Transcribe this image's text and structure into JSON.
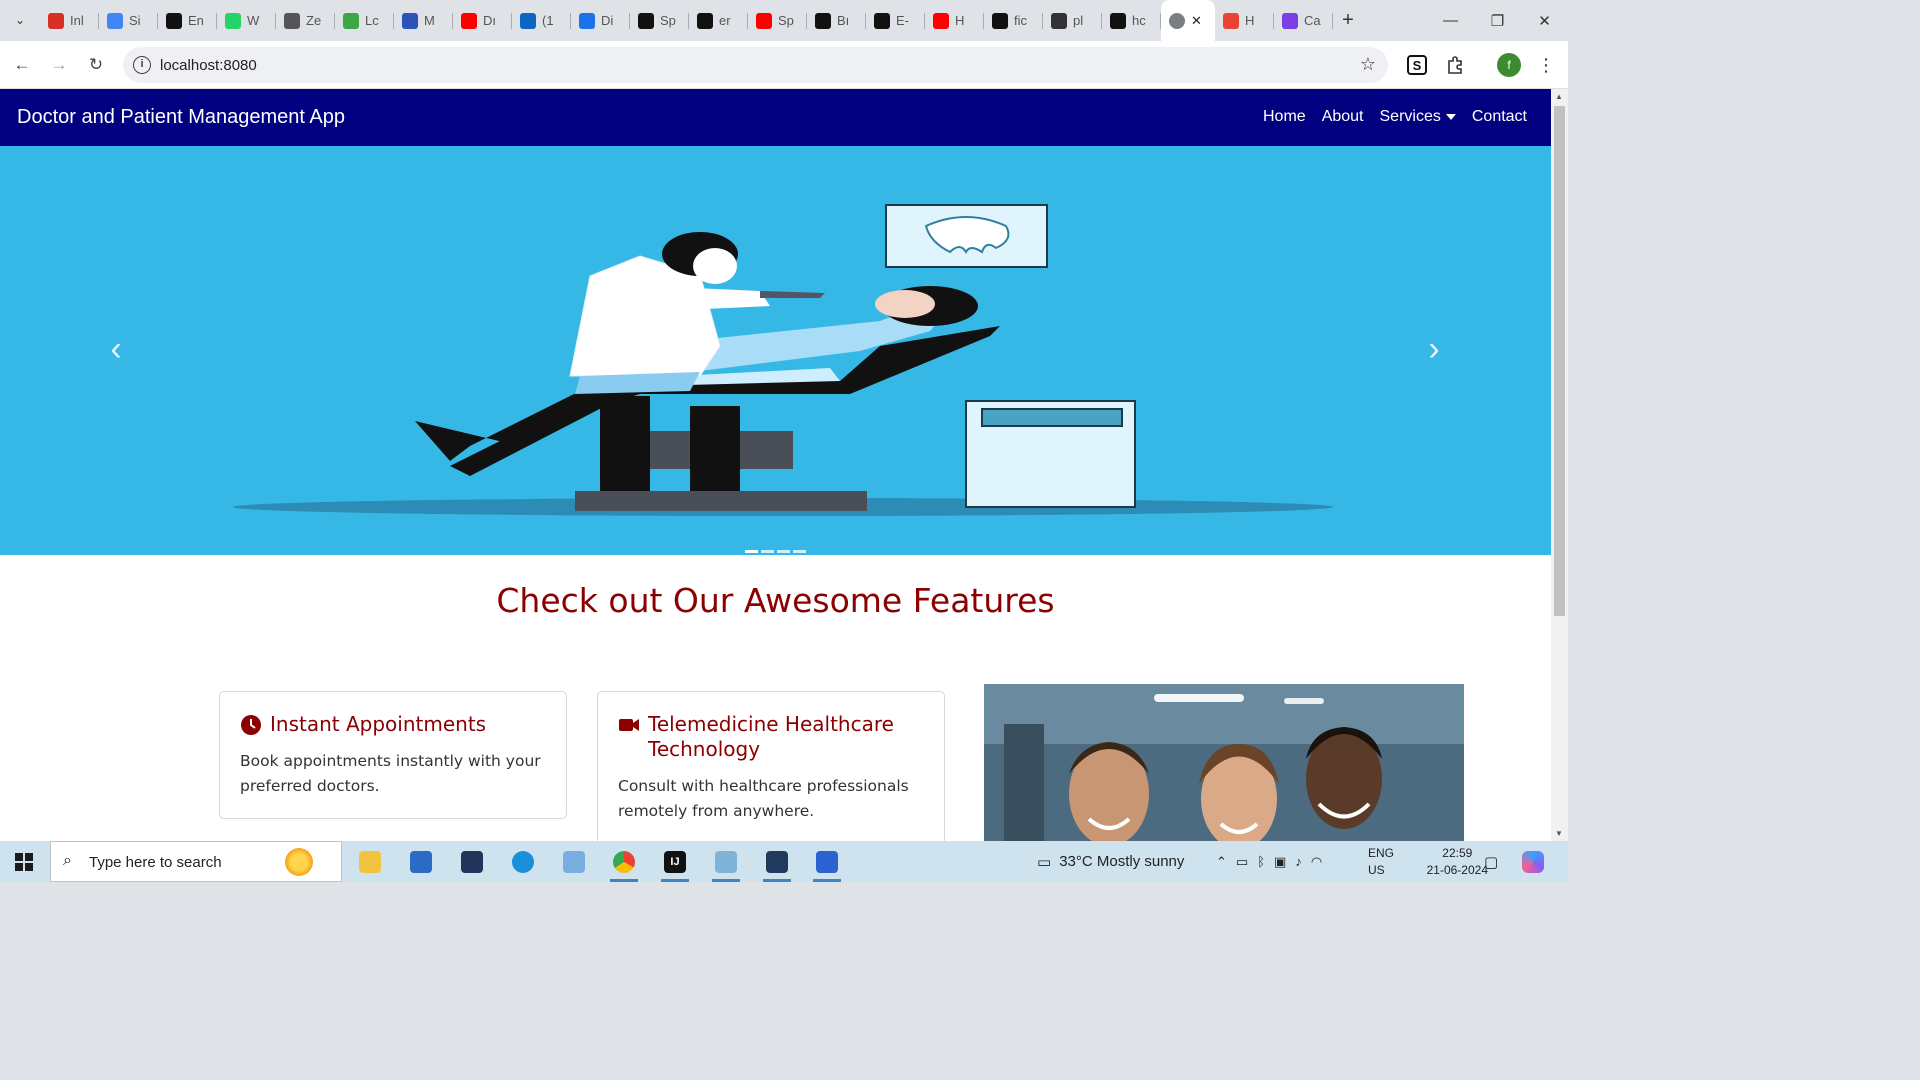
{
  "browser": {
    "tabs": [
      {
        "label": "Inl",
        "favicon": "gmail-icon",
        "color": "#d93025"
      },
      {
        "label": "Si",
        "favicon": "google-icon",
        "color": "#4285f4"
      },
      {
        "label": "En",
        "favicon": "github-icon",
        "color": "#111111"
      },
      {
        "label": "W",
        "favicon": "whatsapp-icon",
        "color": "#25d366"
      },
      {
        "label": "Ze",
        "favicon": "page-icon",
        "color": "#555555"
      },
      {
        "label": "Lc",
        "favicon": "leaf-icon",
        "color": "#3aa845"
      },
      {
        "label": "M",
        "favicon": "mvn-icon",
        "color": "#2a55b8"
      },
      {
        "label": "Dı",
        "favicon": "youtube-icon",
        "color": "#ff0000"
      },
      {
        "label": "(1",
        "favicon": "linkedin-icon",
        "color": "#0a66c2"
      },
      {
        "label": "Di",
        "favicon": "spinner-icon",
        "color": "#1a73e8"
      },
      {
        "label": "Sp",
        "favicon": "github-icon",
        "color": "#111111"
      },
      {
        "label": "er",
        "favicon": "github-icon",
        "color": "#111111"
      },
      {
        "label": "Sp",
        "favicon": "youtube-icon",
        "color": "#ff0000"
      },
      {
        "label": "Bı",
        "favicon": "github-icon",
        "color": "#111111"
      },
      {
        "label": "E-",
        "favicon": "github-icon",
        "color": "#111111"
      },
      {
        "label": "H",
        "favicon": "youtube-icon",
        "color": "#ff0000"
      },
      {
        "label": "fic",
        "favicon": "github-icon",
        "color": "#111111"
      },
      {
        "label": "pl",
        "favicon": "laptop-icon",
        "color": "#333333"
      },
      {
        "label": "hc",
        "favicon": "github-icon",
        "color": "#111111"
      }
    ],
    "active_tab_close": "✕",
    "after_tabs": [
      {
        "label": "H",
        "favicon": "chrome-red-icon",
        "color": "#ea4335"
      },
      {
        "label": "Ca",
        "favicon": "b-icon",
        "color": "#7b3fe4"
      }
    ],
    "new_tab": "+",
    "url": "localhost:8080",
    "profile_letter": "f",
    "extension_letter": "S"
  },
  "page": {
    "brand": "Doctor and Patient Management App",
    "nav": {
      "home": "Home",
      "about": "About",
      "services": "Services",
      "contact": "Contact"
    },
    "carousel": {
      "prev": "‹",
      "next": "›",
      "slides": 4,
      "active_slide": 1
    },
    "features_title": "Check out Our Awesome Features",
    "cards": [
      {
        "title": "Instant Appointments",
        "text": "Book appointments instantly with your preferred doctors."
      },
      {
        "title": "Telemedicine Healthcare Technology",
        "text": "Consult with healthcare professionals remotely from anywhere."
      }
    ],
    "colors": {
      "navbar": "#010080",
      "carousel_bg": "#36b8e6",
      "heading": "#8b0000"
    }
  },
  "taskbar": {
    "search_placeholder": "Type here to search",
    "weather": "33°C  Mostly sunny",
    "lang_top": "ENG",
    "lang_bottom": "US",
    "time": "22:59",
    "date": "21-06-2024"
  }
}
